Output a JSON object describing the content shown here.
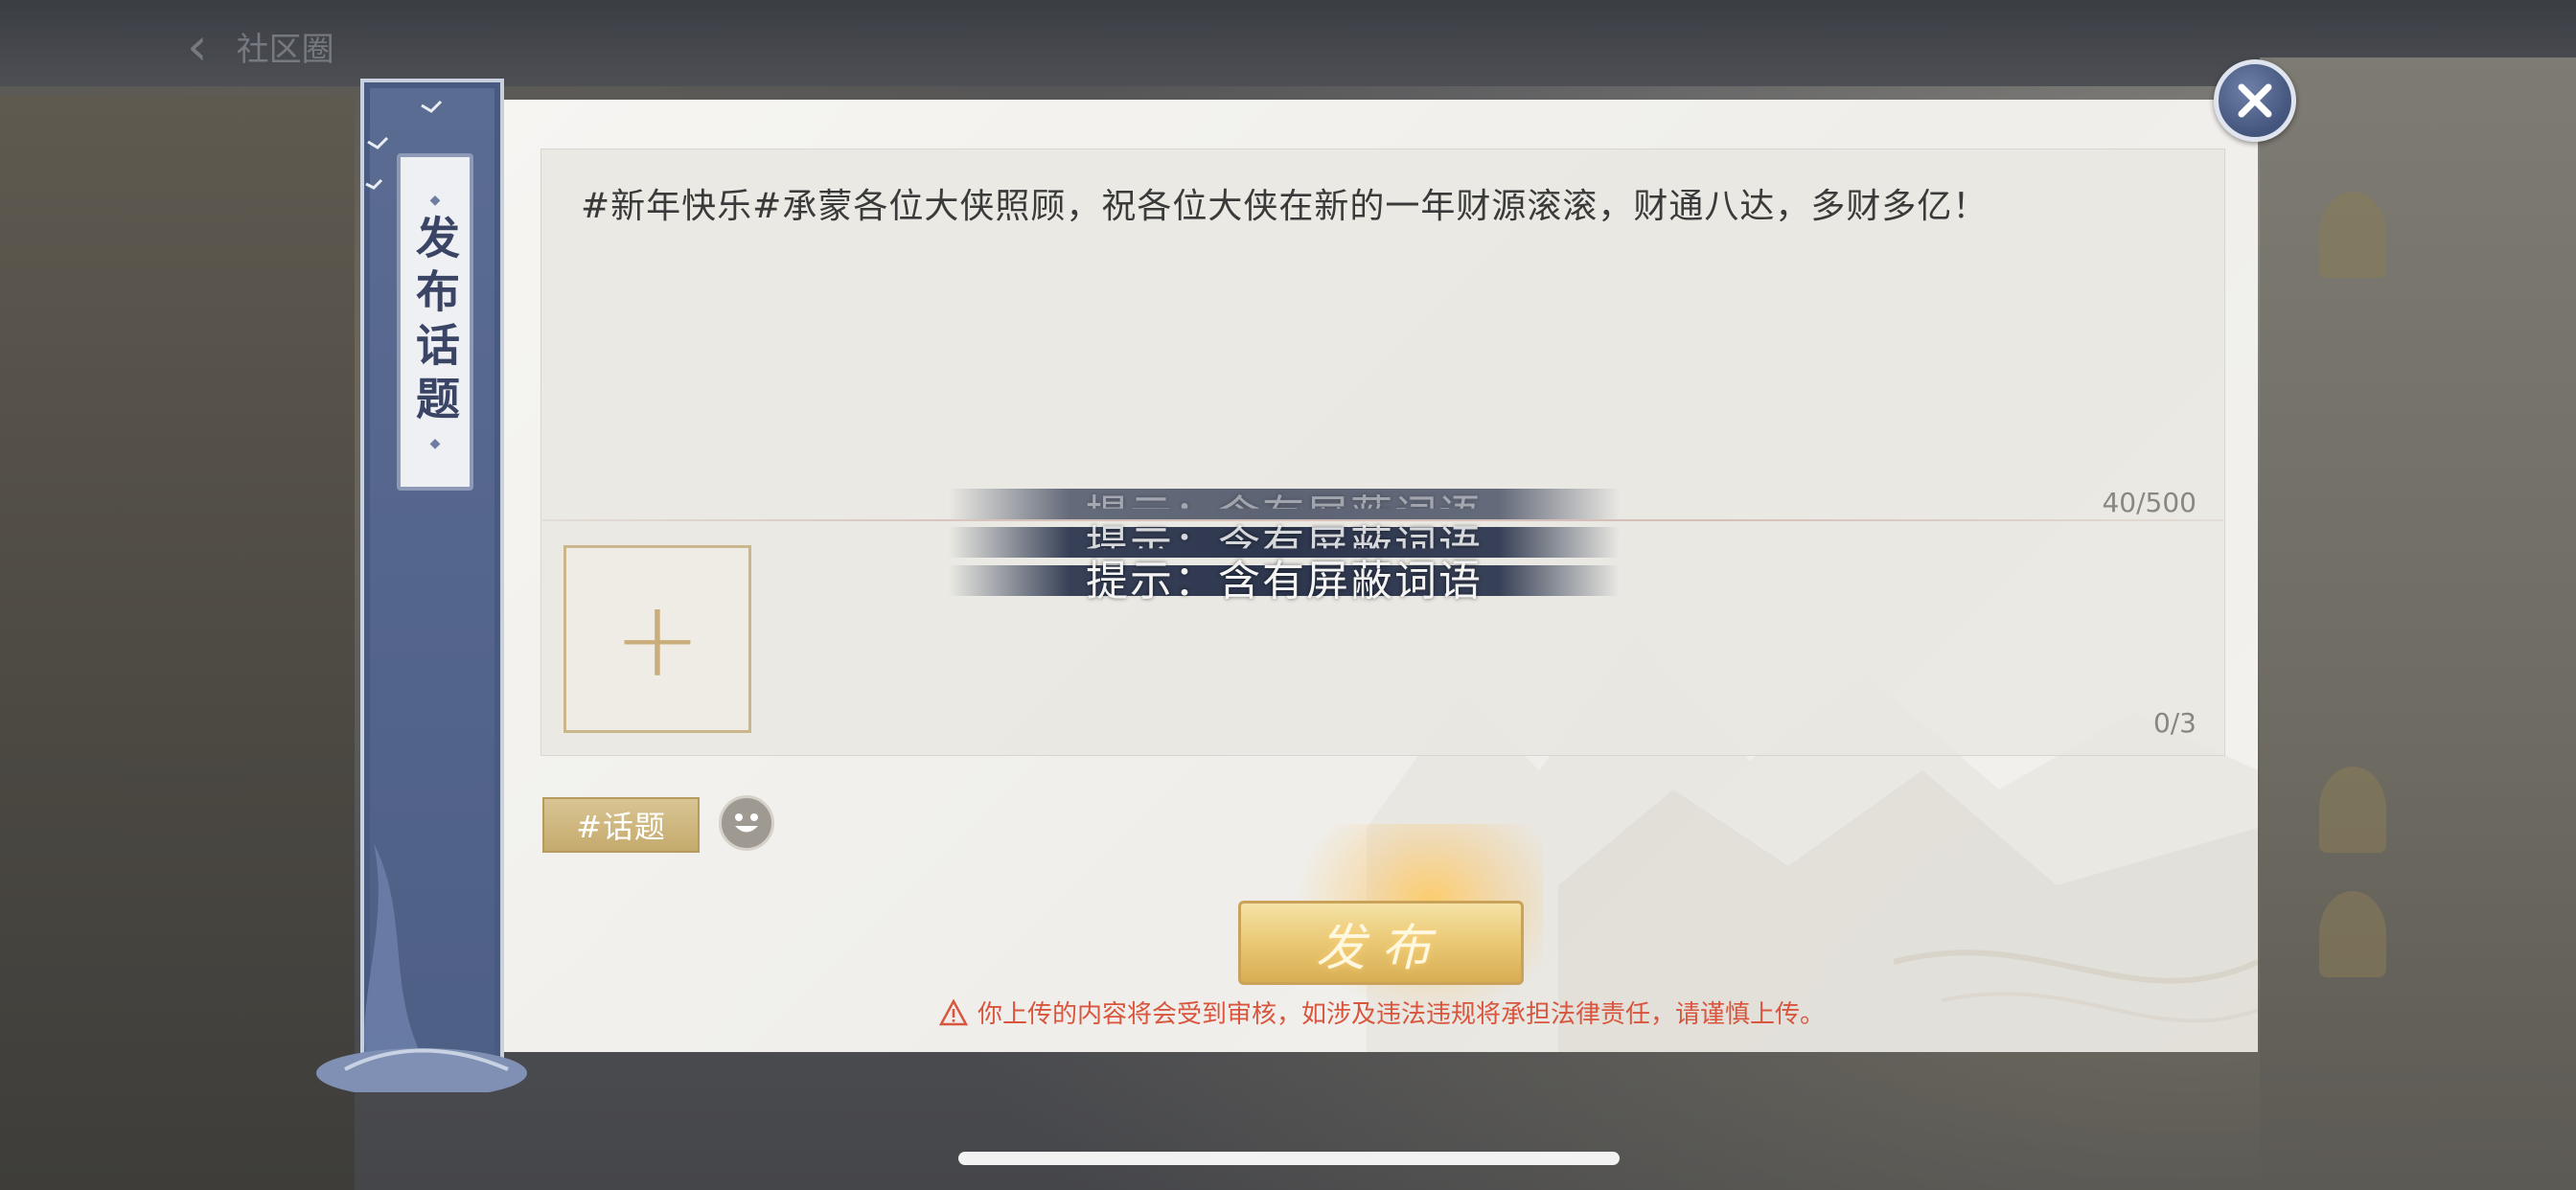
{
  "background": {
    "back_label": "社区圈"
  },
  "sidebar": {
    "title": "发布话题"
  },
  "editor": {
    "text": "#新年快乐#承蒙各位大侠照顾，祝各位大侠在新的一年财源滚滚，财通八达，多财多亿！",
    "char_count": "40/500",
    "image_count": "0/3",
    "add_image_symbol": "+"
  },
  "toast": {
    "message": "提示：含有屏蔽词语"
  },
  "toolbar": {
    "topic_label": "#话题",
    "emoji_icon": "smiley-icon"
  },
  "publish": {
    "label": "发布"
  },
  "warning": {
    "text": "你上传的内容将会受到审核，如涉及违法违规将承担法律责任，请谨慎上传。"
  },
  "colors": {
    "accent_gold": "#d9c593",
    "panel_blue": "#53648b",
    "warning_red": "#d9553d"
  }
}
